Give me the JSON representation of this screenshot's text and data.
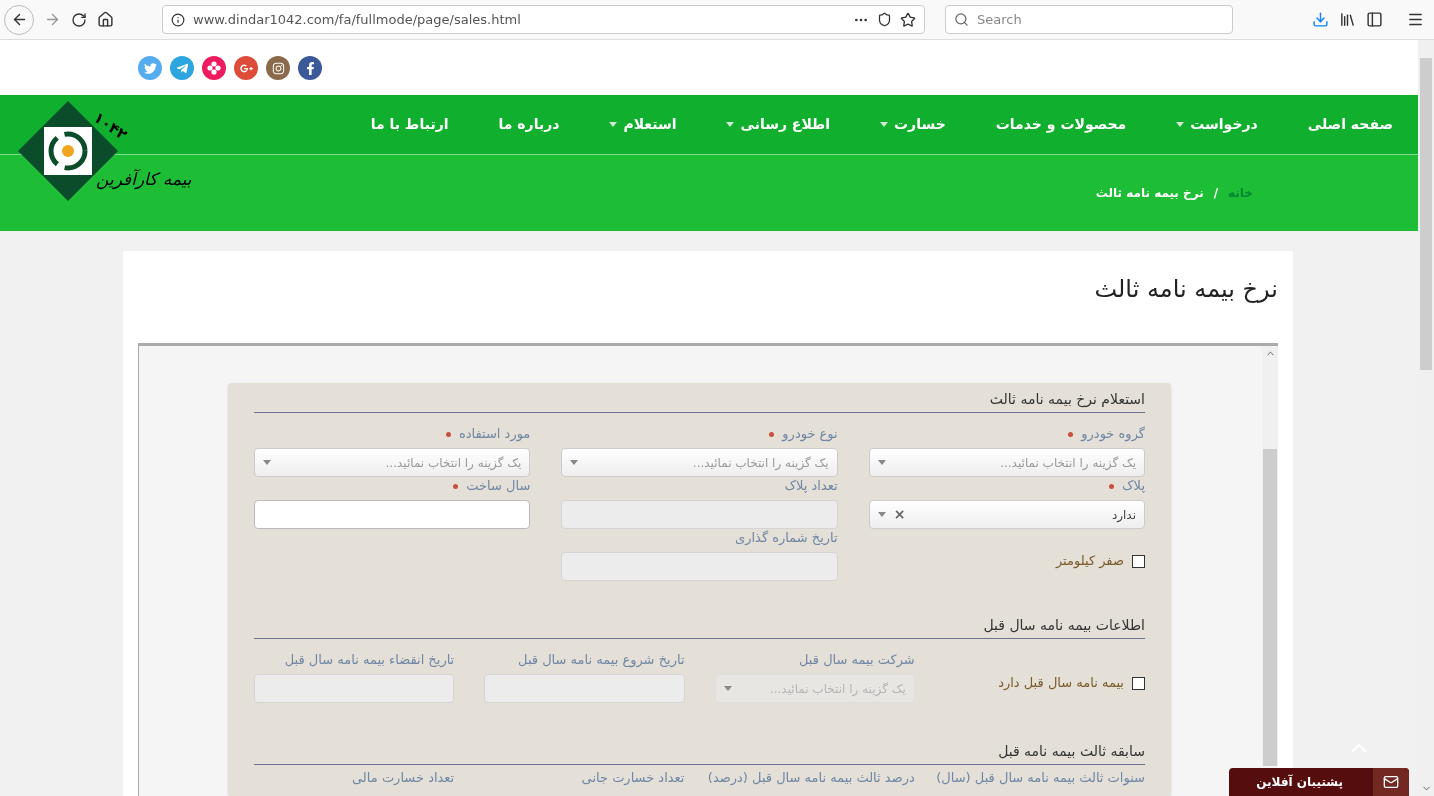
{
  "browser": {
    "url": "www.dindar1042.com/fa/fullmode/page/sales.html",
    "search_placeholder": "Search"
  },
  "logo": {
    "name": "بیمه کارآفرین",
    "number": "۱۰۴۲"
  },
  "nav": [
    {
      "label": "صفحه اصلی",
      "dropdown": false
    },
    {
      "label": "درخواست",
      "dropdown": true
    },
    {
      "label": "محصولات و خدمات",
      "dropdown": false
    },
    {
      "label": "خسارت",
      "dropdown": true
    },
    {
      "label": "اطلاع رسانی",
      "dropdown": true
    },
    {
      "label": "استعلام",
      "dropdown": true
    },
    {
      "label": "درباره ما",
      "dropdown": false
    },
    {
      "label": "ارتباط با ما",
      "dropdown": false
    }
  ],
  "breadcrumb": [
    "خانه",
    "/",
    "نرخ بیمه نامه ثالث"
  ],
  "page_title": "نرخ بیمه نامه ثالث",
  "sections": [
    {
      "title": "استعلام نرخ بیمه نامه ثالث",
      "fields": [
        {
          "kind": "select",
          "label": "گروه خودرو",
          "required": true,
          "disabled": false,
          "placeholder": "یک گزینه را انتخاب نمائید..."
        },
        {
          "kind": "select",
          "label": "نوع خودرو",
          "required": true,
          "disabled": false,
          "placeholder": "یک گزینه را انتخاب نمائید..."
        },
        {
          "kind": "select",
          "label": "مورد استفاده",
          "required": true,
          "disabled": false,
          "placeholder": "یک گزینه را انتخاب نمائید..."
        },
        {
          "kind": "select",
          "label": "پلاک",
          "required": true,
          "disabled": false,
          "value": "ندارد",
          "clear": "×"
        },
        {
          "kind": "input",
          "label": "تعداد پلاک",
          "required": false,
          "disabled": true
        },
        {
          "kind": "input",
          "label": "سال ساخت",
          "required": true,
          "disabled": false
        },
        {
          "kind": "checkbox",
          "label": "صفر کیلومتر",
          "checked": false
        },
        {
          "kind": "input",
          "label": "تاریخ شماره گذاری",
          "required": false,
          "disabled": true
        }
      ]
    },
    {
      "title": "اطلاعات بیمه نامه سال قبل",
      "fields": [
        {
          "kind": "checkbox",
          "label": "بیمه نامه سال قبل دارد",
          "checked": false
        },
        {
          "kind": "select",
          "label": "شرکت بیمه سال قبل",
          "required": false,
          "disabled": true,
          "placeholder": "یک گزینه را انتخاب نمائید..."
        },
        {
          "kind": "input",
          "label": "تاریخ شروع بیمه نامه سال قبل",
          "required": false,
          "disabled": true
        },
        {
          "kind": "input",
          "label": "تاریخ انقضاء بیمه نامه سال قبل",
          "required": false,
          "disabled": true
        }
      ]
    },
    {
      "title": "سابقه ثالث بیمه نامه قبل",
      "fields": [
        {
          "kind": "label",
          "label": "سنوات ثالث بیمه نامه سال قبل (سال)"
        },
        {
          "kind": "label",
          "label": "درصد ثالث بیمه نامه سال قبل (درصد)"
        },
        {
          "kind": "label",
          "label": "تعداد خسارت جانی"
        },
        {
          "kind": "label",
          "label": "تعداد خسارت مالی"
        }
      ]
    }
  ],
  "support": {
    "label": "پشتیبان آفلاین"
  }
}
